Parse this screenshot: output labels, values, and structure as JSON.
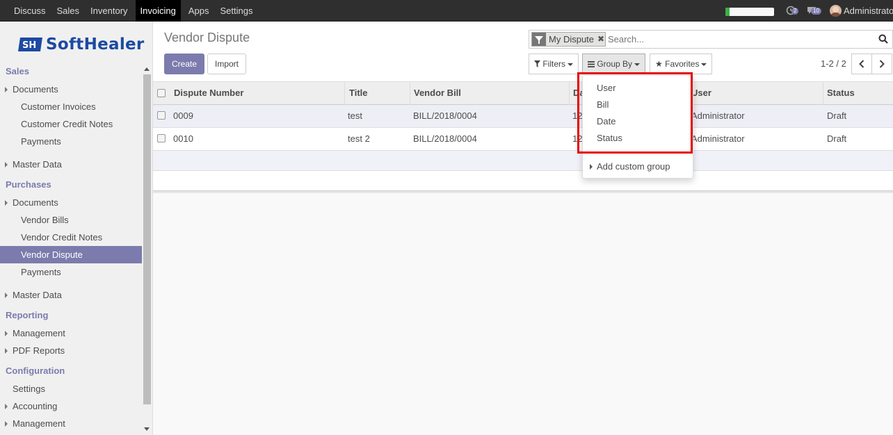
{
  "topbar": {
    "menu": [
      "Discuss",
      "Sales",
      "Inventory",
      "Invoicing",
      "Apps",
      "Settings"
    ],
    "active": "Invoicing",
    "progress": 0.08,
    "activity_count": "2",
    "message_count": "10",
    "user": "Administrator"
  },
  "logo": {
    "text": "SoftHealer"
  },
  "sidebar": {
    "sales": "Sales",
    "sales_documents": "Documents",
    "customer_invoices": "Customer Invoices",
    "customer_credit_notes": "Customer Credit Notes",
    "sales_payments": "Payments",
    "sales_master_data": "Master Data",
    "purchases": "Purchases",
    "purchases_documents": "Documents",
    "vendor_bills": "Vendor Bills",
    "vendor_credit_notes": "Vendor Credit Notes",
    "vendor_dispute": "Vendor Dispute",
    "purchases_payments": "Payments",
    "purchases_master_data": "Master Data",
    "reporting": "Reporting",
    "management": "Management",
    "pdf_reports": "PDF Reports",
    "configuration": "Configuration",
    "settings": "Settings",
    "accounting": "Accounting",
    "config_management": "Management"
  },
  "page": {
    "title": "Vendor Dispute",
    "create": "Create",
    "import": "Import"
  },
  "search": {
    "facet": "My Dispute",
    "placeholder": "Search..."
  },
  "filters": {
    "filters": "Filters",
    "group_by": "Group By",
    "favorites": "Favorites"
  },
  "pager": {
    "value": "1-2 / 2"
  },
  "table": {
    "columns": {
      "dispute_number": "Dispute Number",
      "title": "Title",
      "vendor_bill": "Vendor Bill",
      "date": "Da",
      "user": "User",
      "status": "Status"
    },
    "rows": [
      {
        "dispute_number": "0009",
        "title": "test",
        "vendor_bill": "BILL/2018/0004",
        "date": "12",
        "user": "Administrator",
        "status": "Draft"
      },
      {
        "dispute_number": "0010",
        "title": "test 2",
        "vendor_bill": "BILL/2018/0004",
        "date": "12",
        "user": "Administrator",
        "status": "Draft"
      }
    ]
  },
  "group_by_menu": {
    "options": [
      "User",
      "Bill",
      "Date",
      "Status"
    ],
    "custom": "Add custom group"
  },
  "colors": {
    "accent": "#7c7bad",
    "highlight": "#e60000",
    "topbar": "#2f2f2f"
  }
}
